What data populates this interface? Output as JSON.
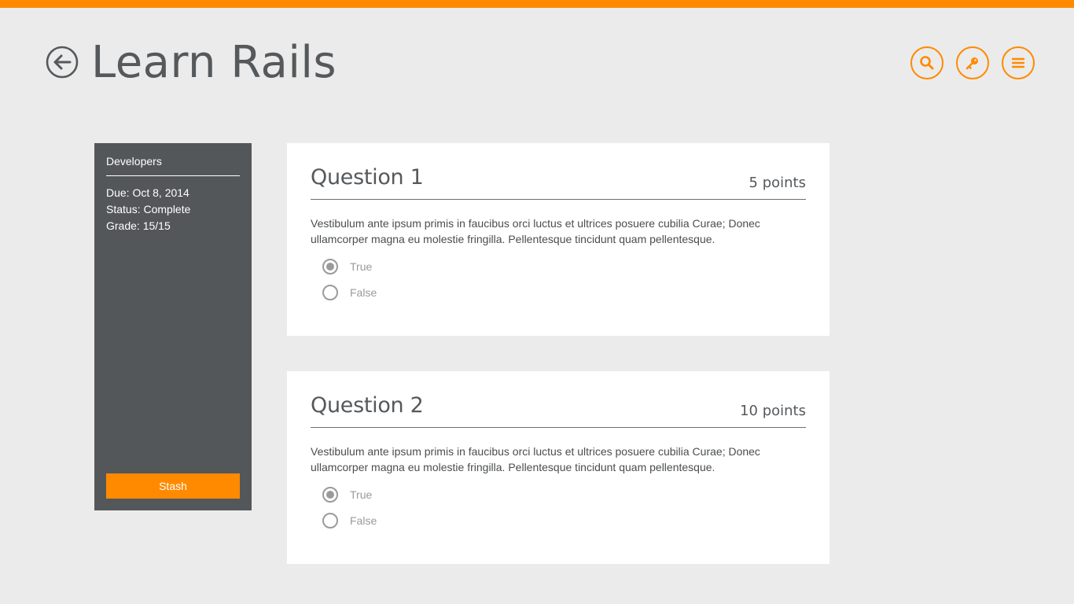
{
  "header": {
    "title": "Learn Rails",
    "accent_color": "#ff8a00",
    "actions": [
      {
        "name": "search",
        "icon": "search-icon"
      },
      {
        "name": "key",
        "icon": "key-icon"
      },
      {
        "name": "menu",
        "icon": "menu-icon"
      }
    ]
  },
  "sidebar": {
    "group": "Developers",
    "due": "Due: Oct 8, 2014",
    "status": "Status: Complete",
    "grade": "Grade: 15/15",
    "stash_label": "Stash"
  },
  "questions": [
    {
      "title": "Question 1",
      "points": "5 points",
      "text": "Vestibulum ante ipsum primis in faucibus orci luctus et ultrices posuere cubilia Curae; Donec ullamcorper magna eu molestie fringilla. Pellentesque tincidunt quam pellentesque.",
      "options": [
        {
          "label": "True",
          "selected": true
        },
        {
          "label": "False",
          "selected": false
        }
      ]
    },
    {
      "title": "Question 2",
      "points": "10 points",
      "text": "Vestibulum ante ipsum primis in faucibus orci luctus et ultrices posuere cubilia Curae; Donec ullamcorper magna eu molestie fringilla. Pellentesque tincidunt quam pellentesque.",
      "options": [
        {
          "label": "True",
          "selected": true
        },
        {
          "label": "False",
          "selected": false
        }
      ]
    }
  ]
}
